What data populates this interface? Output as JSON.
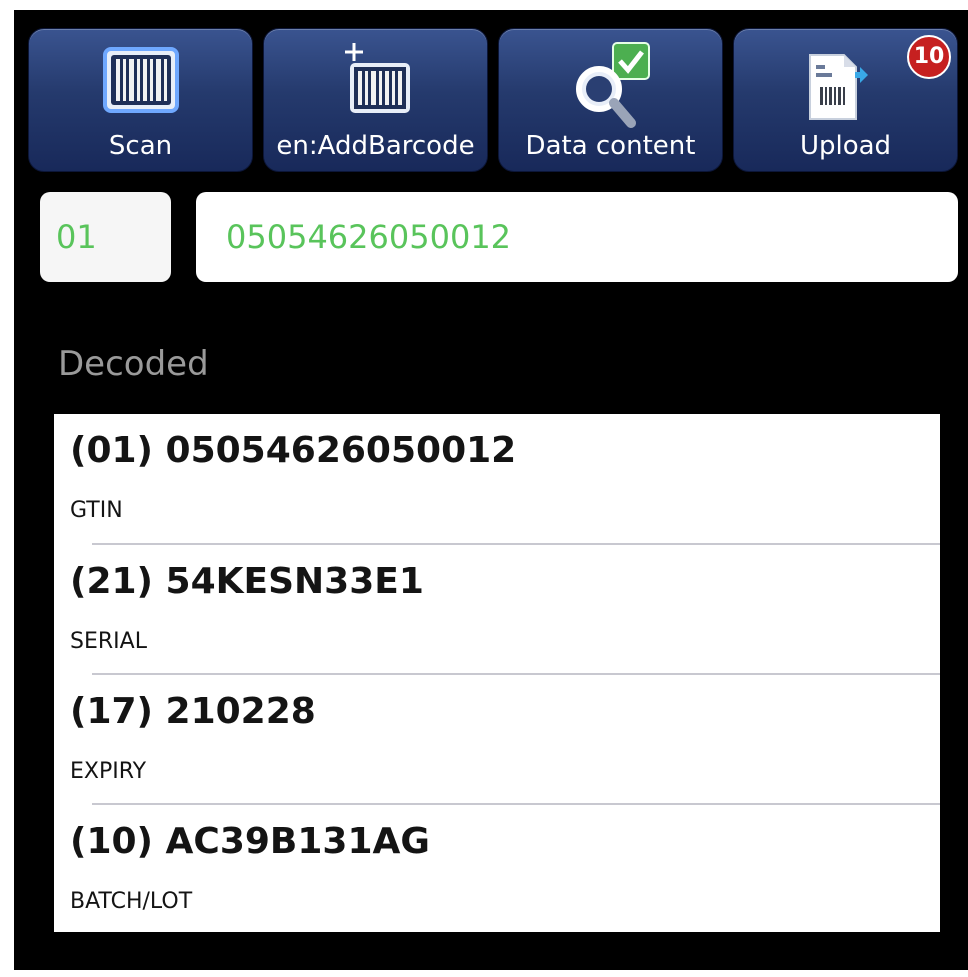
{
  "toolbar": {
    "buttons": [
      {
        "label": "Scan",
        "icon": "barcode-icon"
      },
      {
        "label": "en:AddBarcode",
        "icon": "add-barcode-icon"
      },
      {
        "label": "Data content",
        "icon": "search-check-icon"
      },
      {
        "label": "Upload",
        "icon": "upload-document-icon",
        "badge": "10"
      }
    ]
  },
  "input": {
    "ai": "01",
    "value": "05054626050012"
  },
  "decoded": {
    "heading": "Decoded",
    "items": [
      {
        "code": "(01) 05054626050012",
        "label": "GTIN"
      },
      {
        "code": "(21) 54KESN33E1",
        "label": "SERIAL"
      },
      {
        "code": "(17) 210228",
        "label": "EXPIRY"
      },
      {
        "code": "(10) AC39B131AG",
        "label": "BATCH/LOT"
      }
    ]
  },
  "colors": {
    "background": "#000000",
    "toolbar_button": "#253a6d",
    "input_text_green": "#59c45b",
    "badge_red": "#c62020",
    "heading_gray": "#9a9a9a"
  }
}
